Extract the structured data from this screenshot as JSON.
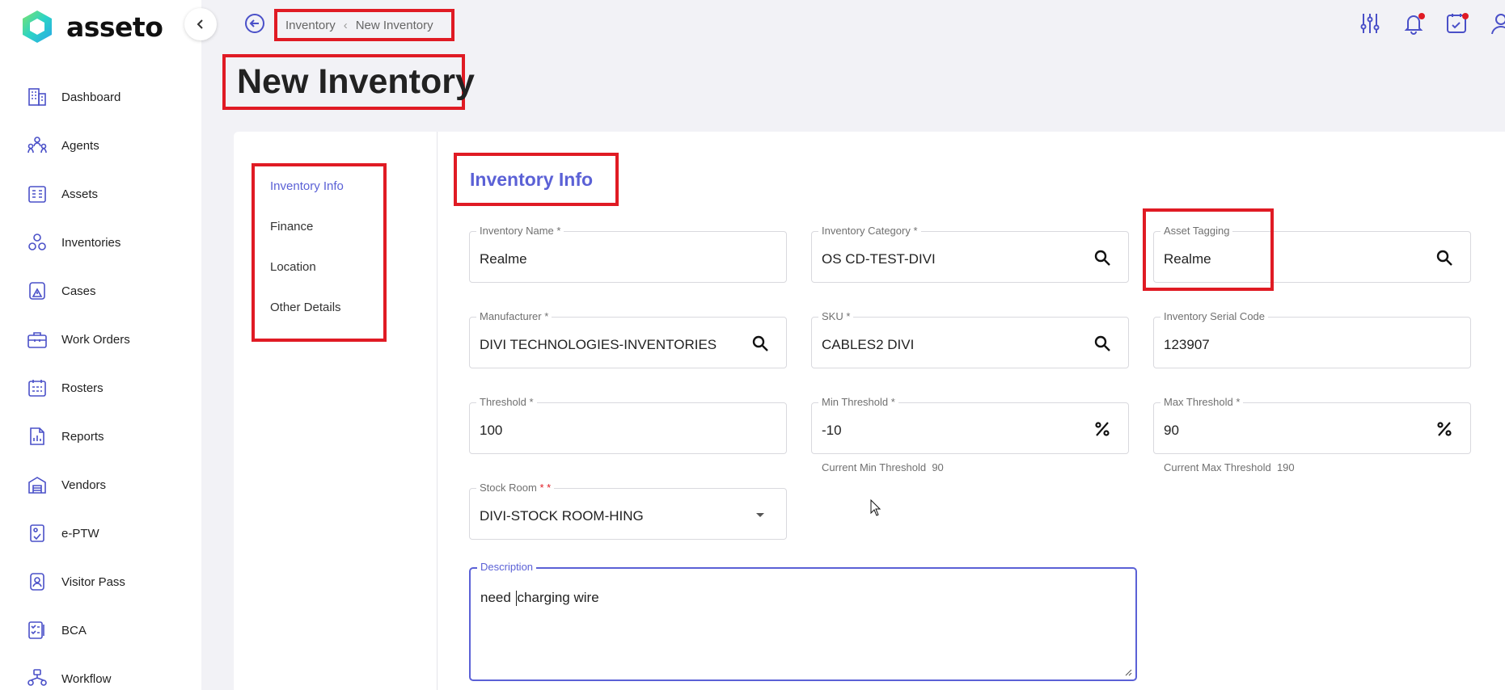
{
  "app": {
    "name": "asseto"
  },
  "sidebar": {
    "items": [
      {
        "label": "Dashboard",
        "icon": "building-icon"
      },
      {
        "label": "Agents",
        "icon": "agents-icon"
      },
      {
        "label": "Assets",
        "icon": "assets-icon"
      },
      {
        "label": "Inventories",
        "icon": "inventories-icon"
      },
      {
        "label": "Cases",
        "icon": "cases-icon"
      },
      {
        "label": "Work Orders",
        "icon": "toolbox-icon"
      },
      {
        "label": "Rosters",
        "icon": "calendar-icon"
      },
      {
        "label": "Reports",
        "icon": "reports-icon"
      },
      {
        "label": "Vendors",
        "icon": "warehouse-icon"
      },
      {
        "label": "e-PTW",
        "icon": "permit-icon"
      },
      {
        "label": "Visitor Pass",
        "icon": "badge-icon"
      },
      {
        "label": "BCA",
        "icon": "checklist-icon"
      },
      {
        "label": "Workflow",
        "icon": "workflow-icon"
      }
    ]
  },
  "breadcrumb": {
    "parent": "Inventory",
    "current": "New Inventory"
  },
  "page": {
    "title": "New Inventory"
  },
  "tabs": [
    {
      "label": "Inventory Info",
      "active": true
    },
    {
      "label": "Finance",
      "active": false
    },
    {
      "label": "Location",
      "active": false
    },
    {
      "label": "Other Details",
      "active": false
    }
  ],
  "section": {
    "title": "Inventory Info"
  },
  "fields": {
    "inventory_name": {
      "label": "Inventory Name",
      "required": "*",
      "value": "Realme"
    },
    "inventory_category": {
      "label": "Inventory Category",
      "required": "*",
      "value": "OS CD-TEST-DIVI"
    },
    "asset_tagging": {
      "label": "Asset Tagging",
      "value": "Realme"
    },
    "manufacturer": {
      "label": "Manufacturer",
      "required": "*",
      "value": "DIVI TECHNOLOGIES-INVENTORIES"
    },
    "sku": {
      "label": "SKU",
      "required": "*",
      "value": "CABLES2 DIVI"
    },
    "serial_code": {
      "label": "Inventory Serial Code",
      "value": "123907"
    },
    "threshold": {
      "label": "Threshold",
      "required": "*",
      "value": "100"
    },
    "min_threshold": {
      "label": "Min Threshold",
      "required": "*",
      "value": "-10",
      "hint_label": "Current Min Threshold",
      "hint_value": "90"
    },
    "max_threshold": {
      "label": "Max Threshold",
      "required": "*",
      "value": "90",
      "hint_label": "Current Max Threshold",
      "hint_value": "190"
    },
    "stock_room": {
      "label": "Stock Room",
      "required": "* *",
      "value": "DIVI-STOCK ROOM-HING"
    },
    "description": {
      "label": "Description",
      "value_before_caret": "need ",
      "value_after_caret": "charging wire"
    }
  },
  "colors": {
    "accent": "#5b61d6",
    "highlight": "#e01b24",
    "notification": "#e01b24"
  }
}
